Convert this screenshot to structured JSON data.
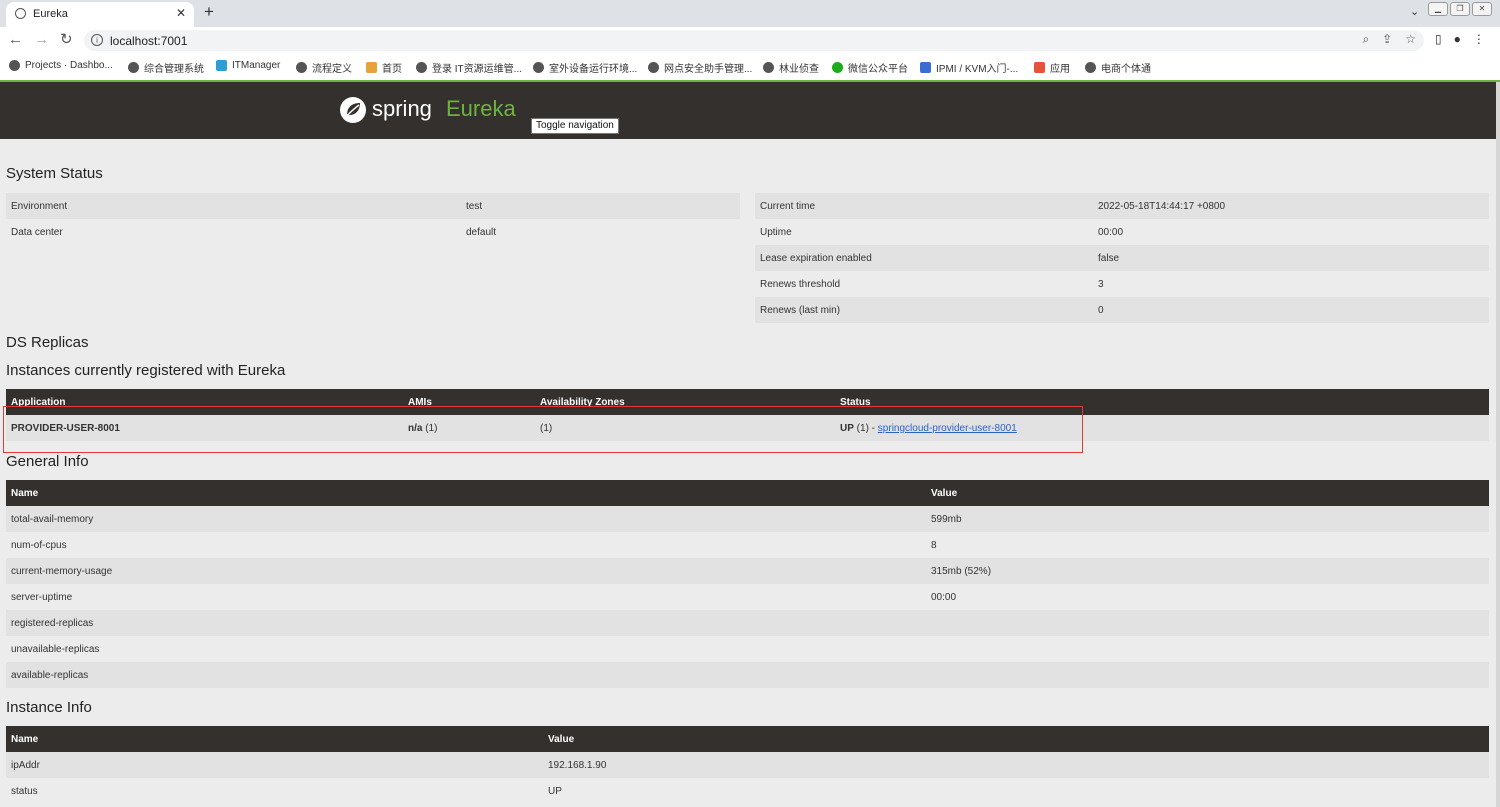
{
  "browser": {
    "tab_title": "Eureka",
    "url": "localhost:7001",
    "bookmarks": [
      "Projects · Dashbo...",
      "综合管理系统",
      "ITManager",
      "流程定义",
      "首页",
      "登录 IT资源运维管...",
      "室外设备运行环境...",
      "网点安全助手管理...",
      "林业侦查",
      "微信公众平台",
      "IPMI / KVM入门-...",
      "应用",
      "电商个体通"
    ]
  },
  "brand": {
    "spring": "spring",
    "eureka": "Eureka",
    "toggle": "Toggle navigation",
    "green": "#6db33f",
    "dark": "#34302d"
  },
  "system_status": {
    "heading": "System Status",
    "left": [
      {
        "k": "Environment",
        "v": "test"
      },
      {
        "k": "Data center",
        "v": "default"
      }
    ],
    "right": [
      {
        "k": "Current time",
        "v": "2022-05-18T14:44:17 +0800"
      },
      {
        "k": "Uptime",
        "v": "00:00"
      },
      {
        "k": "Lease expiration enabled",
        "v": "false"
      },
      {
        "k": "Renews threshold",
        "v": "3"
      },
      {
        "k": "Renews (last min)",
        "v": "0"
      }
    ]
  },
  "ds_replicas": {
    "heading": "DS Replicas"
  },
  "instances": {
    "heading": "Instances currently registered with Eureka",
    "columns": [
      "Application",
      "AMIs",
      "Availability Zones",
      "Status"
    ],
    "rows": [
      {
        "application": "PROVIDER-USER-8001",
        "amis_bold": "n/a",
        "amis_rest": " (1)",
        "zones": "(1)",
        "status_bold": "UP",
        "status_rest": " (1) - ",
        "link": "springcloud-provider-user-8001"
      }
    ]
  },
  "general_info": {
    "heading": "General Info",
    "columns": [
      "Name",
      "Value"
    ],
    "rows": [
      {
        "k": "total-avail-memory",
        "v": "599mb"
      },
      {
        "k": "num-of-cpus",
        "v": "8"
      },
      {
        "k": "current-memory-usage",
        "v": "315mb (52%)"
      },
      {
        "k": "server-uptime",
        "v": "00:00"
      },
      {
        "k": "registered-replicas",
        "v": ""
      },
      {
        "k": "unavailable-replicas",
        "v": ""
      },
      {
        "k": "available-replicas",
        "v": ""
      }
    ]
  },
  "instance_info": {
    "heading": "Instance Info",
    "columns": [
      "Name",
      "Value"
    ],
    "rows": [
      {
        "k": "ipAddr",
        "v": "192.168.1.90"
      },
      {
        "k": "status",
        "v": "UP"
      }
    ]
  }
}
